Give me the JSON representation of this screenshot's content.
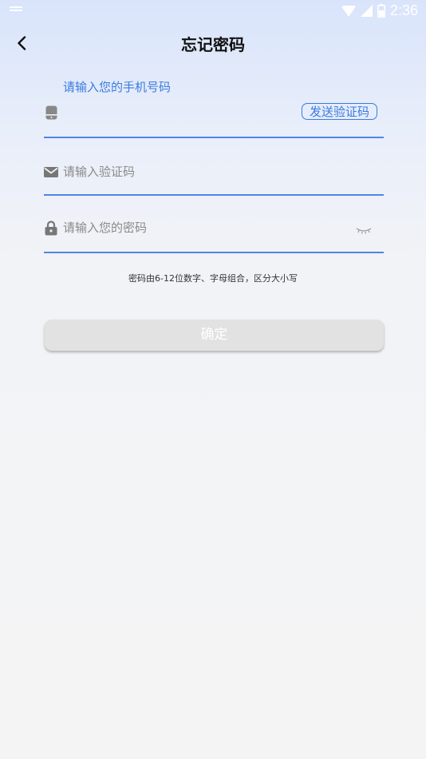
{
  "status_bar": {
    "time": "2:36"
  },
  "header": {
    "title": "忘记密码"
  },
  "form": {
    "phone": {
      "label": "请输入您的手机号码",
      "value": "",
      "placeholder": ""
    },
    "send_code_label": "发送验证码",
    "code": {
      "placeholder": "请输入验证码",
      "value": ""
    },
    "password": {
      "placeholder": "请输入您的密码",
      "value": ""
    },
    "rule_text": "密码由6-12位数字、字母组合，区分大小写",
    "confirm_label": "确定"
  },
  "colors": {
    "accent": "#3a7be0",
    "underline": "#4f86e6",
    "button_disabled": "#e2e2e2"
  }
}
